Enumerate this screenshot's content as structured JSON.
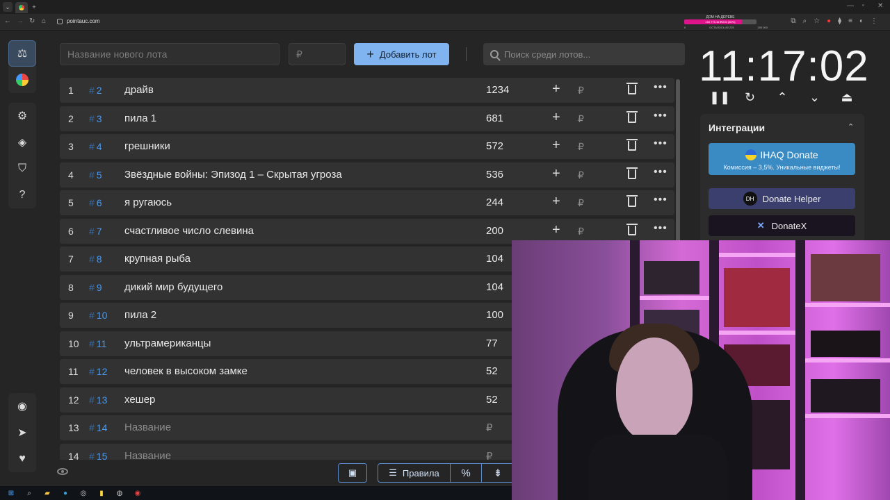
{
  "browser": {
    "url": "pointauc.com",
    "promo": {
      "title": "ДОМ НА ДЕРЕВЕ",
      "progress_text": "160 775.16 ₽/200 (80%)",
      "progress": 0.8,
      "range_left": "0",
      "range_mid": "ОСТАЛОСЬ 80 225",
      "range_right": "200 000"
    }
  },
  "toolbar": {
    "new_lot_placeholder": "Название нового лота",
    "price_placeholder": "₽",
    "add_label": "Добавить лот",
    "search_placeholder": "Поиск среди лотов..."
  },
  "lots": [
    {
      "idx": "1",
      "hash": "2",
      "name": "драйв",
      "amount": "1234"
    },
    {
      "idx": "2",
      "hash": "3",
      "name": "пила 1",
      "amount": "681"
    },
    {
      "idx": "3",
      "hash": "4",
      "name": "грешники",
      "amount": "572"
    },
    {
      "idx": "4",
      "hash": "5",
      "name": "Звёздные войны: Эпизод 1 – Скрытая угроза",
      "amount": "536"
    },
    {
      "idx": "5",
      "hash": "6",
      "name": "я ругаюсь",
      "amount": "244"
    },
    {
      "idx": "6",
      "hash": "7",
      "name": "счастливое число слевина",
      "amount": "200"
    },
    {
      "idx": "7",
      "hash": "8",
      "name": "крупная рыба",
      "amount": "104"
    },
    {
      "idx": "8",
      "hash": "9",
      "name": "дикий мир будущего",
      "amount": "104"
    },
    {
      "idx": "9",
      "hash": "10",
      "name": "пила 2",
      "amount": "100"
    },
    {
      "idx": "10",
      "hash": "11",
      "name": "ультрамериканцы",
      "amount": "77"
    },
    {
      "idx": "11",
      "hash": "12",
      "name": "человек в высоком замке",
      "amount": "52"
    },
    {
      "idx": "12",
      "hash": "13",
      "name": "хешер",
      "amount": "52"
    },
    {
      "idx": "13",
      "hash": "14",
      "name": "Название",
      "amount": "₽",
      "placeholder": true
    },
    {
      "idx": "14",
      "hash": "15",
      "name": "Название",
      "amount": "₽",
      "placeholder": true
    }
  ],
  "lot_row": {
    "hash_symbol": "#",
    "rub": "₽",
    "plus": "+",
    "more": "•••"
  },
  "bottom": {
    "rules_label": "Правила",
    "pct_label": "%",
    "split_label": "⇟"
  },
  "timer": {
    "value": "11:17:02"
  },
  "integrations": {
    "title": "Интеграции",
    "ihaq_title": "IHAQ Donate",
    "ihaq_sub": "Комиссия – 3,5%. Уникальные виджеты!",
    "dh_logo": "DH",
    "dh_label": "Donate Helper",
    "dx_label": "DonateX"
  },
  "colors": {
    "accent": "#7fb4f0",
    "hash": "#4a9aef",
    "ihaq": "#3a8bc4",
    "dh": "#3a3f6e"
  },
  "icons": [
    "auction-icon",
    "pie-chart-icon",
    "gear-icon",
    "layers-icon",
    "shield-icon",
    "help-icon",
    "github-icon",
    "telegram-icon",
    "donate-icon",
    "eye-icon",
    "save-icon",
    "search-icon",
    "trash-icon",
    "pause-icon",
    "reset-icon",
    "chevron-up-icon",
    "chevron-down-icon",
    "eject-icon"
  ]
}
